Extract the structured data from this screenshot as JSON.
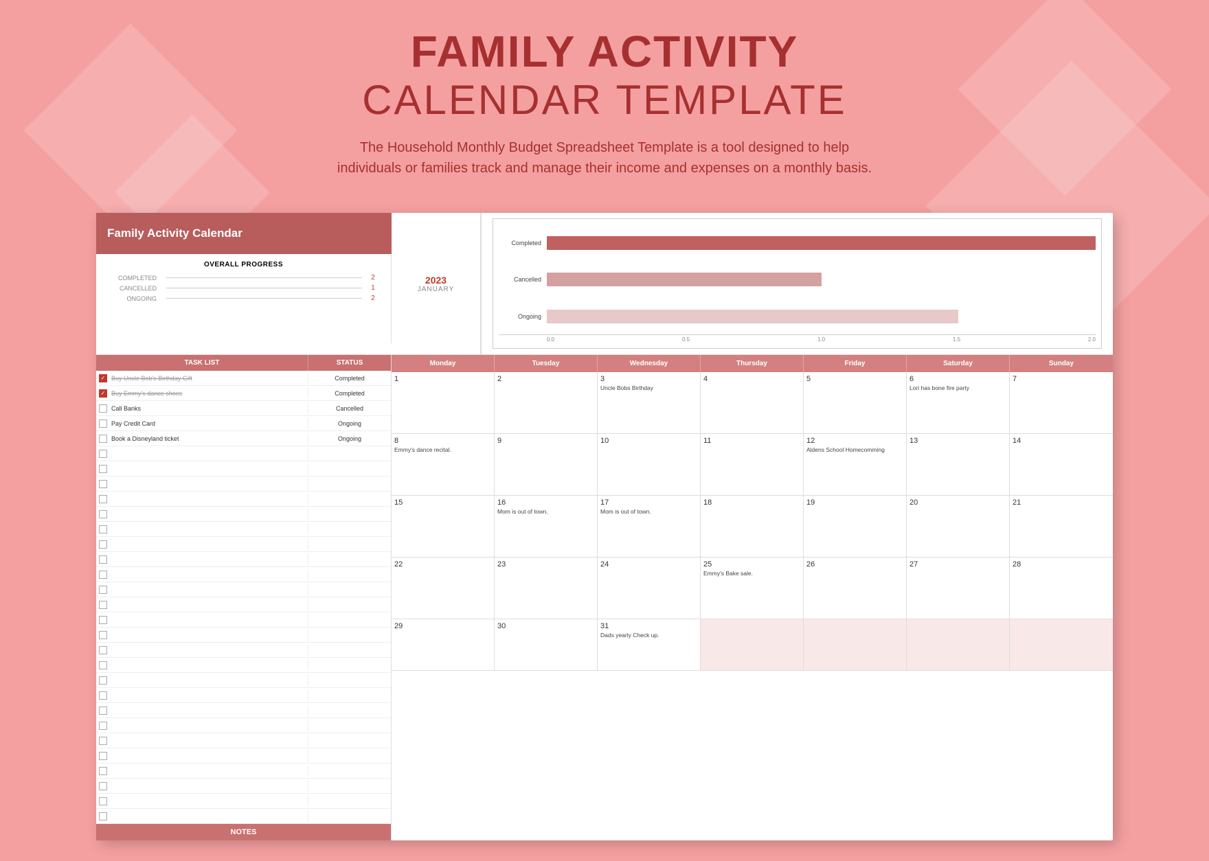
{
  "header": {
    "title_line1": "FAMILY ACTIVITY",
    "title_line2": "CALENDAR TEMPLATE",
    "subtitle": "The Household Monthly Budget Spreadsheet Template is a tool designed to help individuals or families track and manage their income and expenses on a monthly basis."
  },
  "spreadsheet": {
    "title": "Family Activity Calendar",
    "year": "2023",
    "month": "JANUARY",
    "progress": {
      "title": "OVERALL PROGRESS",
      "completed_label": "COMPLETED",
      "completed_value": "2",
      "cancelled_label": "CANCELLED",
      "cancelled_value": "1",
      "ongoing_label": "ONGOING",
      "ongoing_value": "2"
    },
    "chart": {
      "labels": [
        "Completed",
        "Cancelled",
        "Ongoing"
      ],
      "bars": [
        2.0,
        1.0,
        1.5
      ],
      "max": 2.0,
      "x_axis": [
        "0.0",
        "0.5",
        "1.0",
        "1.5",
        "2.0"
      ]
    },
    "task_list": {
      "col_task": "TASK LIST",
      "col_status": "STATUS",
      "tasks": [
        {
          "text": "Buy Uncle Bob's Birthday Gift",
          "status": "Completed",
          "checked": true,
          "strikethrough": true
        },
        {
          "text": "Buy Emmy's dance shoes",
          "status": "Completed",
          "checked": true,
          "strikethrough": true
        },
        {
          "text": "Call Banks",
          "status": "Cancelled",
          "checked": false,
          "strikethrough": false
        },
        {
          "text": "Pay Credit Card",
          "status": "Ongoing",
          "checked": false,
          "strikethrough": false
        },
        {
          "text": "Book a Disneyland ticket",
          "status": "Ongoing",
          "checked": false,
          "strikethrough": false
        },
        {
          "text": "",
          "status": "",
          "checked": false,
          "strikethrough": false
        },
        {
          "text": "",
          "status": "",
          "checked": false,
          "strikethrough": false
        },
        {
          "text": "",
          "status": "",
          "checked": false,
          "strikethrough": false
        },
        {
          "text": "",
          "status": "",
          "checked": false,
          "strikethrough": false
        },
        {
          "text": "",
          "status": "",
          "checked": false,
          "strikethrough": false
        },
        {
          "text": "",
          "status": "",
          "checked": false,
          "strikethrough": false
        },
        {
          "text": "",
          "status": "",
          "checked": false,
          "strikethrough": false
        },
        {
          "text": "",
          "status": "",
          "checked": false,
          "strikethrough": false
        },
        {
          "text": "",
          "status": "",
          "checked": false,
          "strikethrough": false
        },
        {
          "text": "",
          "status": "",
          "checked": false,
          "strikethrough": false
        },
        {
          "text": "",
          "status": "",
          "checked": false,
          "strikethrough": false
        },
        {
          "text": "",
          "status": "",
          "checked": false,
          "strikethrough": false
        },
        {
          "text": "",
          "status": "",
          "checked": false,
          "strikethrough": false
        },
        {
          "text": "",
          "status": "",
          "checked": false,
          "strikethrough": false
        },
        {
          "text": "",
          "status": "",
          "checked": false,
          "strikethrough": false
        },
        {
          "text": "",
          "status": "",
          "checked": false,
          "strikethrough": false
        },
        {
          "text": "",
          "status": "",
          "checked": false,
          "strikethrough": false
        },
        {
          "text": "",
          "status": "",
          "checked": false,
          "strikethrough": false
        },
        {
          "text": "",
          "status": "",
          "checked": false,
          "strikethrough": false
        },
        {
          "text": "",
          "status": "",
          "checked": false,
          "strikethrough": false
        },
        {
          "text": "",
          "status": "",
          "checked": false,
          "strikethrough": false
        },
        {
          "text": "",
          "status": "",
          "checked": false,
          "strikethrough": false
        },
        {
          "text": "",
          "status": "",
          "checked": false,
          "strikethrough": false
        },
        {
          "text": "",
          "status": "",
          "checked": false,
          "strikethrough": false
        },
        {
          "text": "",
          "status": "",
          "checked": false,
          "strikethrough": false
        }
      ],
      "notes_label": "NOTES"
    },
    "calendar": {
      "days": [
        "Monday",
        "Tuesday",
        "Wednesday",
        "Thursday",
        "Friday",
        "Saturday",
        "Sunday"
      ],
      "weeks": [
        [
          {
            "num": "1",
            "event": ""
          },
          {
            "num": "2",
            "event": ""
          },
          {
            "num": "3",
            "event": "Uncle Bobs Birthday"
          },
          {
            "num": "4",
            "event": ""
          },
          {
            "num": "5",
            "event": ""
          },
          {
            "num": "6",
            "event": "Lori has bone fire party"
          },
          {
            "num": "7",
            "event": ""
          }
        ],
        [
          {
            "num": "8",
            "event": "Emmy's dance recital."
          },
          {
            "num": "9",
            "event": ""
          },
          {
            "num": "10",
            "event": ""
          },
          {
            "num": "11",
            "event": ""
          },
          {
            "num": "12",
            "event": "Aldens School Homecomming"
          },
          {
            "num": "13",
            "event": ""
          },
          {
            "num": "14",
            "event": ""
          }
        ],
        [
          {
            "num": "15",
            "event": ""
          },
          {
            "num": "16",
            "event": "Mom is out of town."
          },
          {
            "num": "17",
            "event": "Mom is out of town."
          },
          {
            "num": "18",
            "event": ""
          },
          {
            "num": "19",
            "event": ""
          },
          {
            "num": "20",
            "event": ""
          },
          {
            "num": "21",
            "event": ""
          }
        ],
        [
          {
            "num": "22",
            "event": ""
          },
          {
            "num": "23",
            "event": ""
          },
          {
            "num": "24",
            "event": ""
          },
          {
            "num": "25",
            "event": "Emmy's Bake sale."
          },
          {
            "num": "26",
            "event": ""
          },
          {
            "num": "27",
            "event": ""
          },
          {
            "num": "28",
            "event": ""
          }
        ],
        [
          {
            "num": "29",
            "event": ""
          },
          {
            "num": "30",
            "event": ""
          },
          {
            "num": "31",
            "event": "Dads yearly Check up."
          },
          {
            "num": "",
            "event": "",
            "shaded": true
          },
          {
            "num": "",
            "event": "",
            "shaded": true
          },
          {
            "num": "",
            "event": "",
            "shaded": true
          },
          {
            "num": "",
            "event": "",
            "shaded": true
          }
        ]
      ]
    }
  }
}
